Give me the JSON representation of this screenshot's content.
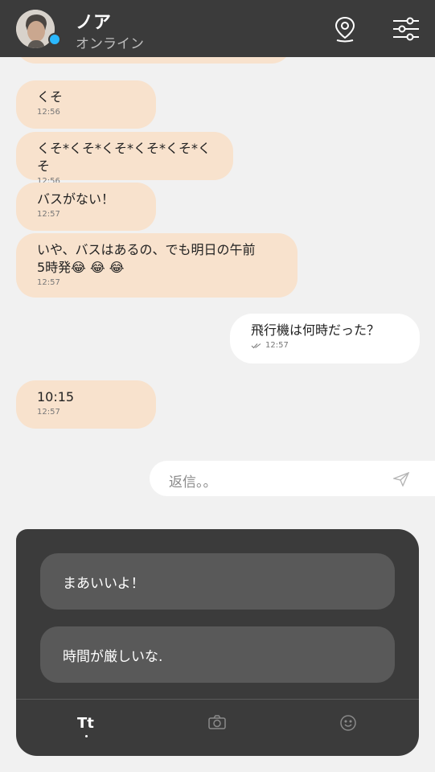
{
  "header": {
    "name": "ノア",
    "status": "オンライン"
  },
  "messages": [
    {
      "direction": "incoming",
      "text": "くそ",
      "time": "12:56"
    },
    {
      "direction": "incoming",
      "text": "くそ*くそ*くそ*くそ*くそ*くそ",
      "time": "12:56"
    },
    {
      "direction": "incoming",
      "text": "バスがない！",
      "time": "12:57"
    },
    {
      "direction": "incoming",
      "text": "いや、バスはあるの、でも明日の午前\n5時発😂 😂 😂",
      "time": "12:57"
    },
    {
      "direction": "outgoing",
      "text": "飛行機は何時だった？",
      "time": "12:57"
    },
    {
      "direction": "incoming",
      "text": "10:15",
      "time": "12:57"
    }
  ],
  "reply": {
    "placeholder": "返信。。"
  },
  "suggestions": [
    {
      "label": "まあいいよ！"
    },
    {
      "label": "時間が厳しいな."
    }
  ],
  "tabs": {
    "text_label": "Tt"
  },
  "colors": {
    "header_bg": "#3b3b3b",
    "incoming_bubble": "#f8e2cd",
    "outgoing_bubble": "#ffffff",
    "online_dot": "#2ab8ff",
    "panel_bg": "#3b3b3b",
    "suggestion_bg": "#595959"
  }
}
